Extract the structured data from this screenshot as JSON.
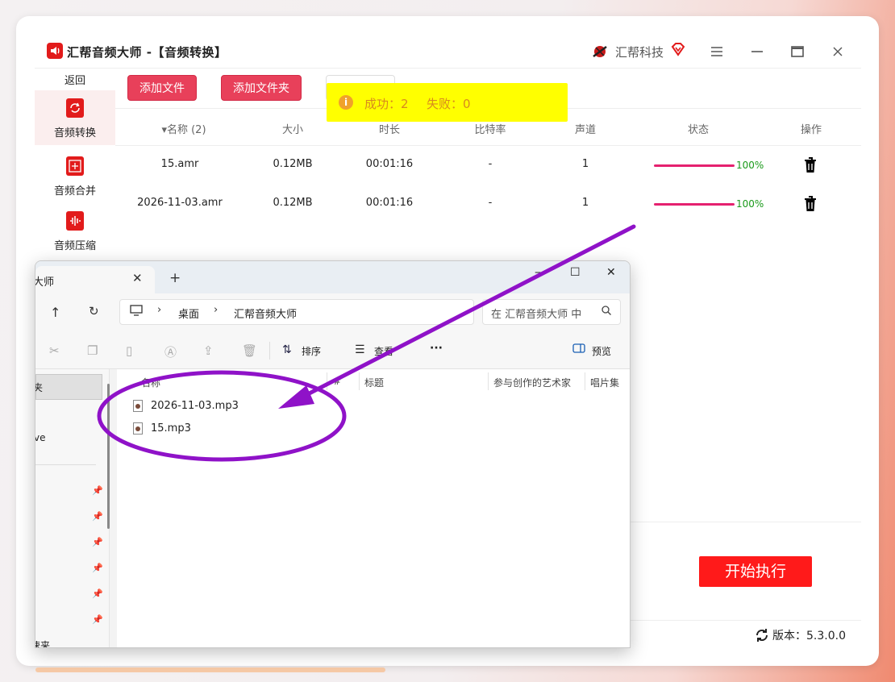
{
  "app": {
    "title": "汇帮音频大师  -【音频转换】",
    "brand": "汇帮科技",
    "menu_icon": "hamburger-icon",
    "min_icon": "minimize-icon",
    "max_icon": "maximize-icon",
    "close_icon": "close-icon"
  },
  "sidebar": {
    "back": "返回",
    "items": [
      {
        "label": "音频转换",
        "icon": "convert-icon",
        "active": true
      },
      {
        "label": "音频合并",
        "icon": "merge-icon",
        "active": false
      },
      {
        "label": "音频压缩",
        "icon": "compress-icon",
        "active": false
      }
    ]
  },
  "toolbar": {
    "add_file": "添加文件",
    "add_folder": "添加文件夹"
  },
  "toast": {
    "success": "成功：2",
    "fail": "失败：0"
  },
  "table": {
    "headers": [
      "▾名称 (2)",
      "大小",
      "时长",
      "比特率",
      "声道",
      "状态",
      "操作"
    ],
    "rows": [
      {
        "name": "15.amr",
        "size": "0.12MB",
        "duration": "00:01:16",
        "bitrate": "-",
        "channels": "1",
        "progress": "100%"
      },
      {
        "name": "2026-11-03.amr",
        "size": "0.12MB",
        "duration": "00:01:16",
        "bitrate": "-",
        "channels": "1",
        "progress": "100%"
      }
    ]
  },
  "actions": {
    "start": "开始执行",
    "version": "版本：5.3.0.0"
  },
  "explorer": {
    "tab_title": "大师",
    "breadcrumb": [
      "桌面",
      "汇帮音频大师"
    ],
    "search_placeholder": "在 汇帮音频大师 中",
    "sort": "排序",
    "view": "查看",
    "more": "···",
    "preview": "预览",
    "columns": [
      "名称",
      "#",
      "标题",
      "参与创作的艺术家",
      "唱片集"
    ],
    "files": [
      "2026-11-03.mp3",
      "15.mp3"
    ],
    "nav_partial": [
      "夹",
      "ve",
      "速来"
    ]
  },
  "colors": {
    "accent_red": "#e21b1b",
    "button_pink": "#e8405a",
    "progress": "#e5216f",
    "toast_bg": "#ffff00",
    "annotation": "#8f12c8"
  }
}
